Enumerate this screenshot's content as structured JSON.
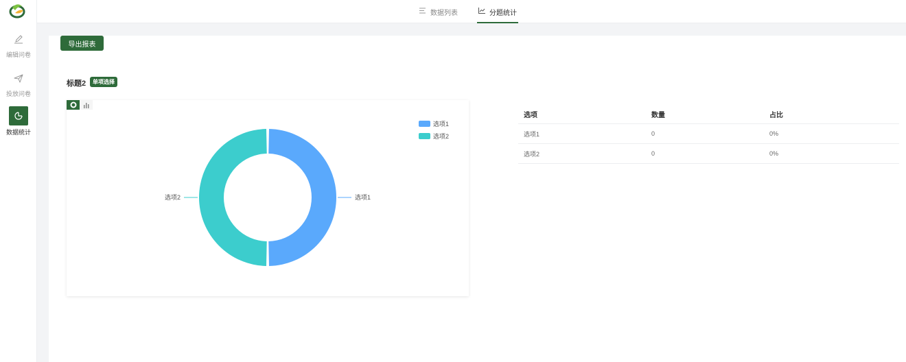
{
  "sidebar": {
    "items": [
      {
        "label": "编辑问卷",
        "icon": "pencil-icon"
      },
      {
        "label": "投放问卷",
        "icon": "send-icon"
      },
      {
        "label": "数据统计",
        "icon": "pie-chart-icon"
      }
    ]
  },
  "tabs": [
    {
      "label": "数据列表",
      "icon": "list-icon"
    },
    {
      "label": "分题统计",
      "icon": "line-chart-icon"
    }
  ],
  "toolbar": {
    "export_label": "导出报表"
  },
  "question": {
    "title": "标题2",
    "type_badge": "单项选择"
  },
  "colors": {
    "accent": "#2e6b3a",
    "series1": "#5aa9fc",
    "series2": "#3ccdcd"
  },
  "chart_data": {
    "type": "pie",
    "donut": true,
    "categories": [
      "选项1",
      "选项2"
    ],
    "values": [
      50,
      50
    ],
    "legend": [
      "选项1",
      "选项2"
    ],
    "legend_position": "top-right"
  },
  "table": {
    "headers": [
      "选项",
      "数量",
      "占比"
    ],
    "rows": [
      [
        "选项1",
        "0",
        "0%"
      ],
      [
        "选项2",
        "0",
        "0%"
      ]
    ]
  }
}
